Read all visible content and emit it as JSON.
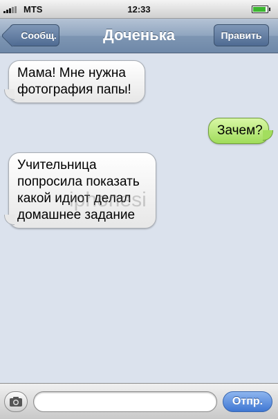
{
  "statusbar": {
    "carrier": "MTS",
    "time": "12:33",
    "battery_level": 0.8,
    "signal_bars": 3
  },
  "navbar": {
    "back_label": "Сообщ.",
    "title": "Доченька",
    "edit_label": "Править"
  },
  "messages": [
    {
      "direction": "incoming",
      "text": "Мама! Мне нужна фотография папы!"
    },
    {
      "direction": "outgoing",
      "text": "Зачем?"
    },
    {
      "direction": "incoming",
      "text": "Учительница попросила показать какой идиот делал домашнее задание"
    }
  ],
  "watermark": "iphonesi",
  "inputbar": {
    "camera_icon": "camera-icon",
    "placeholder": "",
    "send_label": "Отпр."
  },
  "colors": {
    "background": "#dbe2ed",
    "outgoing_bubble": "#a3de5e",
    "incoming_bubble": "#ffffff",
    "send_button": "#3f77d3"
  }
}
